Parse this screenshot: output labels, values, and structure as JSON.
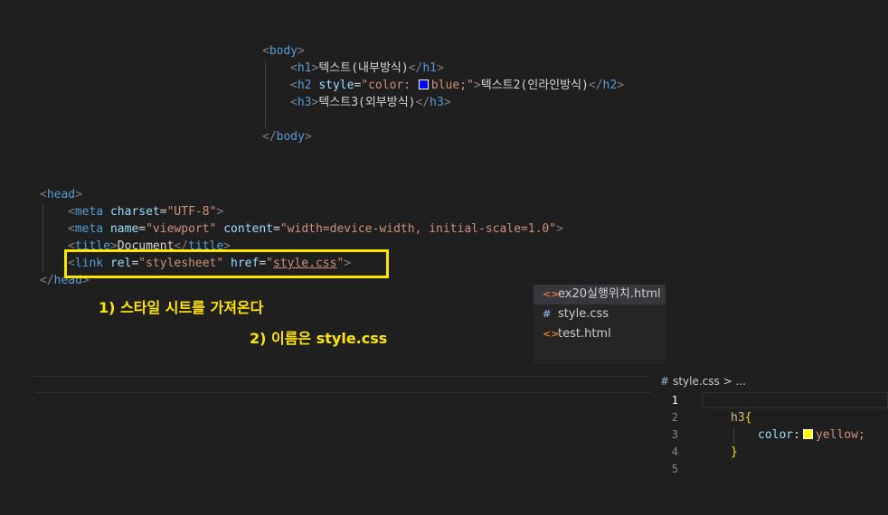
{
  "body_snippet": {
    "body_open": "body",
    "h1_text": "텍스트(내부방식)",
    "h2_style_attr": "style",
    "h2_style_prefix": "\"color: ",
    "h2_style_value": "blue;\"",
    "h2_text": "텍스트2(인라인방식)",
    "h3_text": "텍스트3(외부방식)",
    "body_close": "body"
  },
  "head_snippet": {
    "head_open": "head",
    "meta1_attr": "charset",
    "meta1_value": "\"UTF-8\"",
    "meta2_name_attr": "name",
    "meta2_name_value": "\"viewport\"",
    "meta2_content_attr": "content",
    "meta2_content_value": "\"width=device-width, initial-scale=1.0\"",
    "title_text": "Document",
    "link_rel_attr": "rel",
    "link_rel_value": "\"stylesheet\"",
    "link_href_attr": "href",
    "link_href_value": "style.css",
    "head_close": "head"
  },
  "annotations": {
    "step1": "1) 스타일 시트를 가져온다",
    "step2": "2) 이름은 style.css"
  },
  "explorer": {
    "files": [
      {
        "name": "ex20실행위치.html",
        "icon": "html-file-icon",
        "glyph": "<>"
      },
      {
        "name": "style.css",
        "icon": "css-file-icon",
        "glyph": "#"
      },
      {
        "name": "test.html",
        "icon": "html-file-icon",
        "glyph": "<>"
      }
    ]
  },
  "css_editor": {
    "breadcrumb_file": "style.css",
    "breadcrumb_sep": ">",
    "breadcrumb_more": "...",
    "line_numbers": [
      "1",
      "2",
      "3",
      "4",
      "5"
    ],
    "selector": "h3",
    "open_brace": "{",
    "property": "color",
    "value": "yellow;",
    "close_brace": "}"
  },
  "colors": {
    "blue_swatch": "#0000ff",
    "yellow_swatch": "#ffff00",
    "annotation": "#ffe600"
  }
}
